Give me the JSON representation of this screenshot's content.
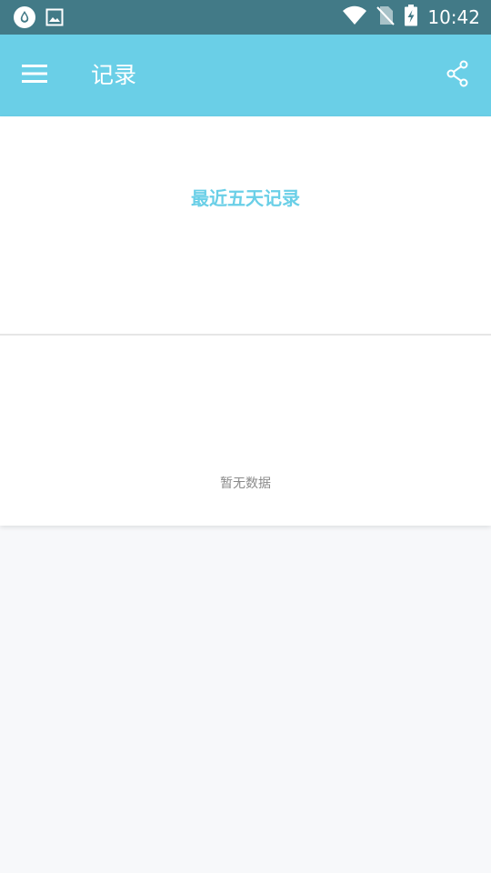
{
  "status_bar": {
    "time": "10:42",
    "icons": [
      "water-drop-icon",
      "image-icon",
      "wifi-icon",
      "no-sim-icon",
      "battery-charging-icon"
    ]
  },
  "app_bar": {
    "title": "记录",
    "menu_icon": "hamburger-menu-icon",
    "share_icon": "share-icon",
    "background_color": "#6acfe7"
  },
  "card": {
    "title": "最近五天记录",
    "empty_text": "暂无数据",
    "title_color": "#6acfe7"
  }
}
